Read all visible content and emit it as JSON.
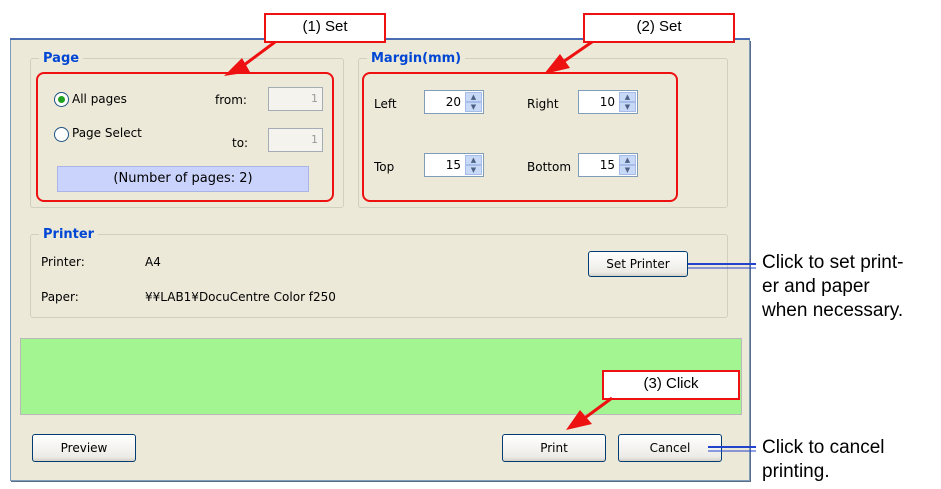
{
  "page_group": {
    "title": "Page",
    "all_pages_label": "All pages",
    "page_select_label": "Page Select",
    "from_label": "from:",
    "to_label": "to:",
    "from_value": "1",
    "to_value": "1",
    "page_count_text": "(Number of pages: 2)"
  },
  "margin_group": {
    "title": "Margin(mm)",
    "left_label": "Left",
    "left_value": "20",
    "right_label": "Right",
    "right_value": "10",
    "top_label": "Top",
    "top_value": "15",
    "bottom_label": "Bottom",
    "bottom_value": "15"
  },
  "printer_group": {
    "title": "Printer",
    "printer_label": "Printer:",
    "printer_value": "A4",
    "paper_label": "Paper:",
    "paper_value": "¥¥LAB1¥DocuCentre Color f250",
    "set_printer_label": "Set Printer"
  },
  "buttons": {
    "preview": "Preview",
    "print": "Print",
    "cancel": "Cancel"
  },
  "callouts": {
    "step1": "(1) Set",
    "step2": "(2) Set",
    "step3": "(3) Click"
  },
  "annotations": {
    "set_printer_line1": "Click to set print-",
    "set_printer_line2": "er and paper",
    "set_printer_line3": "when necessary.",
    "cancel_line1": "Click to cancel",
    "cancel_line2": "printing."
  },
  "colors": {
    "group_title": "#0046d5",
    "progress_area": "#a3f591",
    "callout_red": "#ee1111",
    "annotation_line": "#2244cc"
  }
}
